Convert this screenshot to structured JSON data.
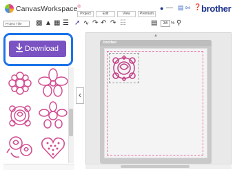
{
  "app": {
    "title": "CanvasWorkspace",
    "brand": "brother",
    "trademark": "®"
  },
  "menu": {
    "items": [
      "Project",
      "Edit",
      "View",
      "Premium"
    ]
  },
  "header_icons": [
    "user-icon",
    "cart-icon",
    "logout-icon",
    "help-icon"
  ],
  "toolbar": {
    "project_title_placeholder": "Project Title",
    "zoom_value": "34",
    "zoom_unit": "%",
    "tools": [
      "add-image-icon",
      "upload-icon",
      "trash-icon",
      "layers-icon",
      "select-icon",
      "draw-icon",
      "shape-icon",
      "undo-icon",
      "redo-icon",
      "delete-icon",
      "align-icon"
    ]
  },
  "sidebar": {
    "download_label": "Download",
    "thumbnails": [
      "lace-circle",
      "lace-flower",
      "lace-rose",
      "lace-daisy",
      "rose-bouquet",
      "lace-heart"
    ]
  },
  "canvas": {
    "mat_brand": "brother"
  },
  "colors": {
    "accent": "#7b52c2",
    "highlight": "#1a73e8",
    "pattern": "#d14d91",
    "brand": "#1a2f8c"
  }
}
